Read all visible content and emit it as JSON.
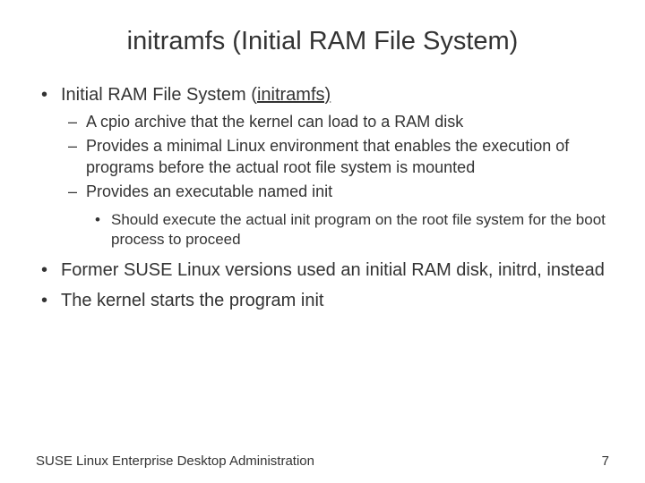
{
  "title": "initramfs (Initial RAM File System)",
  "bullets": {
    "b1": {
      "pre": "Initial RAM File System (",
      "u": "initramfs)",
      "sub": {
        "s1": "A cpio archive that the kernel can load to a RAM disk",
        "s2": "Provides a minimal Linux environment that enables the execution of programs before the actual root file system is mounted",
        "s3": "Provides an executable named init",
        "s3sub": "Should execute the actual init program on the root file system for the boot process to proceed"
      }
    },
    "b2": "Former SUSE Linux versions used an initial RAM disk, initrd, instead",
    "b3": "The kernel starts the program init"
  },
  "footer": {
    "left": "SUSE Linux Enterprise Desktop Administration",
    "right": "7"
  }
}
